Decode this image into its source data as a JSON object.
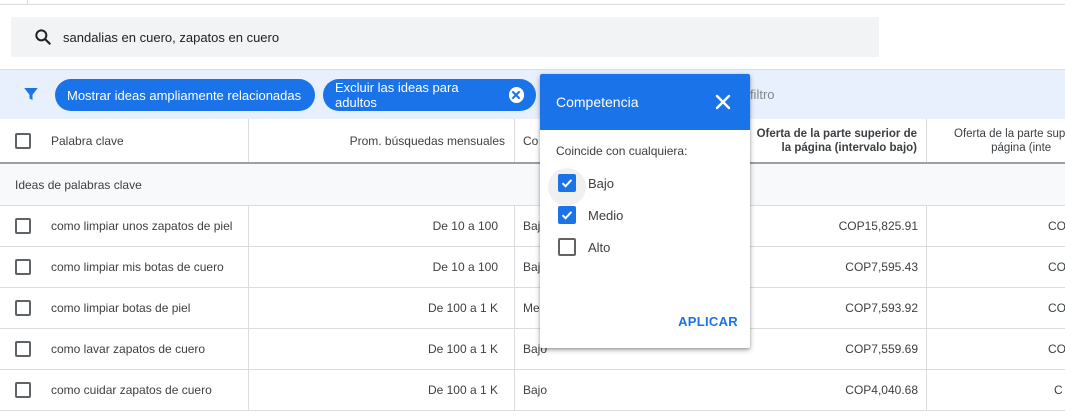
{
  "search": {
    "query": "sandalias en cuero, zapatos en cuero"
  },
  "filters": {
    "chip_broad": "Mostrar ideas ampliamente relacionadas",
    "chip_adult": "Excluir las ideas para adultos",
    "add_filter_partial": "r filtro"
  },
  "table": {
    "columns": {
      "keyword": "Palabra clave",
      "avg_searches": "Prom. búsquedas mensuales",
      "competition_partial": "Co",
      "top_bid_low_line1": "Oferta de la parte superior de",
      "top_bid_low_line2": "la página (intervalo bajo)",
      "top_bid_high_line1": "Oferta de la parte superior",
      "top_bid_high_line2": "página (inte"
    },
    "group_label": "Ideas de palabras clave",
    "rows": [
      {
        "keyword": "como limpiar unos zapatos de piel",
        "searches": "De 10 a 100",
        "competition": "Baj",
        "bid_low": "COP15,825.91",
        "bid_high": "CO"
      },
      {
        "keyword": "como limpiar mis botas de cuero",
        "searches": "De 10 a 100",
        "competition": "Baj",
        "bid_low": "COP7,595.43",
        "bid_high": "CO"
      },
      {
        "keyword": "como limpiar botas de piel",
        "searches": "De 100 a 1 K",
        "competition": "Me",
        "bid_low": "COP7,593.92",
        "bid_high": "CO"
      },
      {
        "keyword": "como lavar zapatos de cuero",
        "searches": "De 100 a 1 K",
        "competition": "Bajo",
        "bid_low": "COP7,559.69",
        "bid_high": "CO"
      },
      {
        "keyword": "como cuidar zapatos de cuero",
        "searches": "De 100 a 1 K",
        "competition": "Bajo",
        "bid_low": "COP4,040.68",
        "bid_high": "C"
      }
    ]
  },
  "popup": {
    "title": "Competencia",
    "subtitle": "Coincide con cualquiera:",
    "options": [
      {
        "label": "Bajo",
        "checked": true
      },
      {
        "label": "Medio",
        "checked": true
      },
      {
        "label": "Alto",
        "checked": false
      }
    ],
    "apply_label": "APLICAR"
  },
  "icons": {
    "search": "search-icon",
    "filter": "filter-icon",
    "close": "close-icon",
    "check": "check-icon"
  },
  "colors": {
    "accent": "#1a73e8",
    "filterbar_bg": "#e8f0fe",
    "searchbar_bg": "#f1f3f4"
  }
}
